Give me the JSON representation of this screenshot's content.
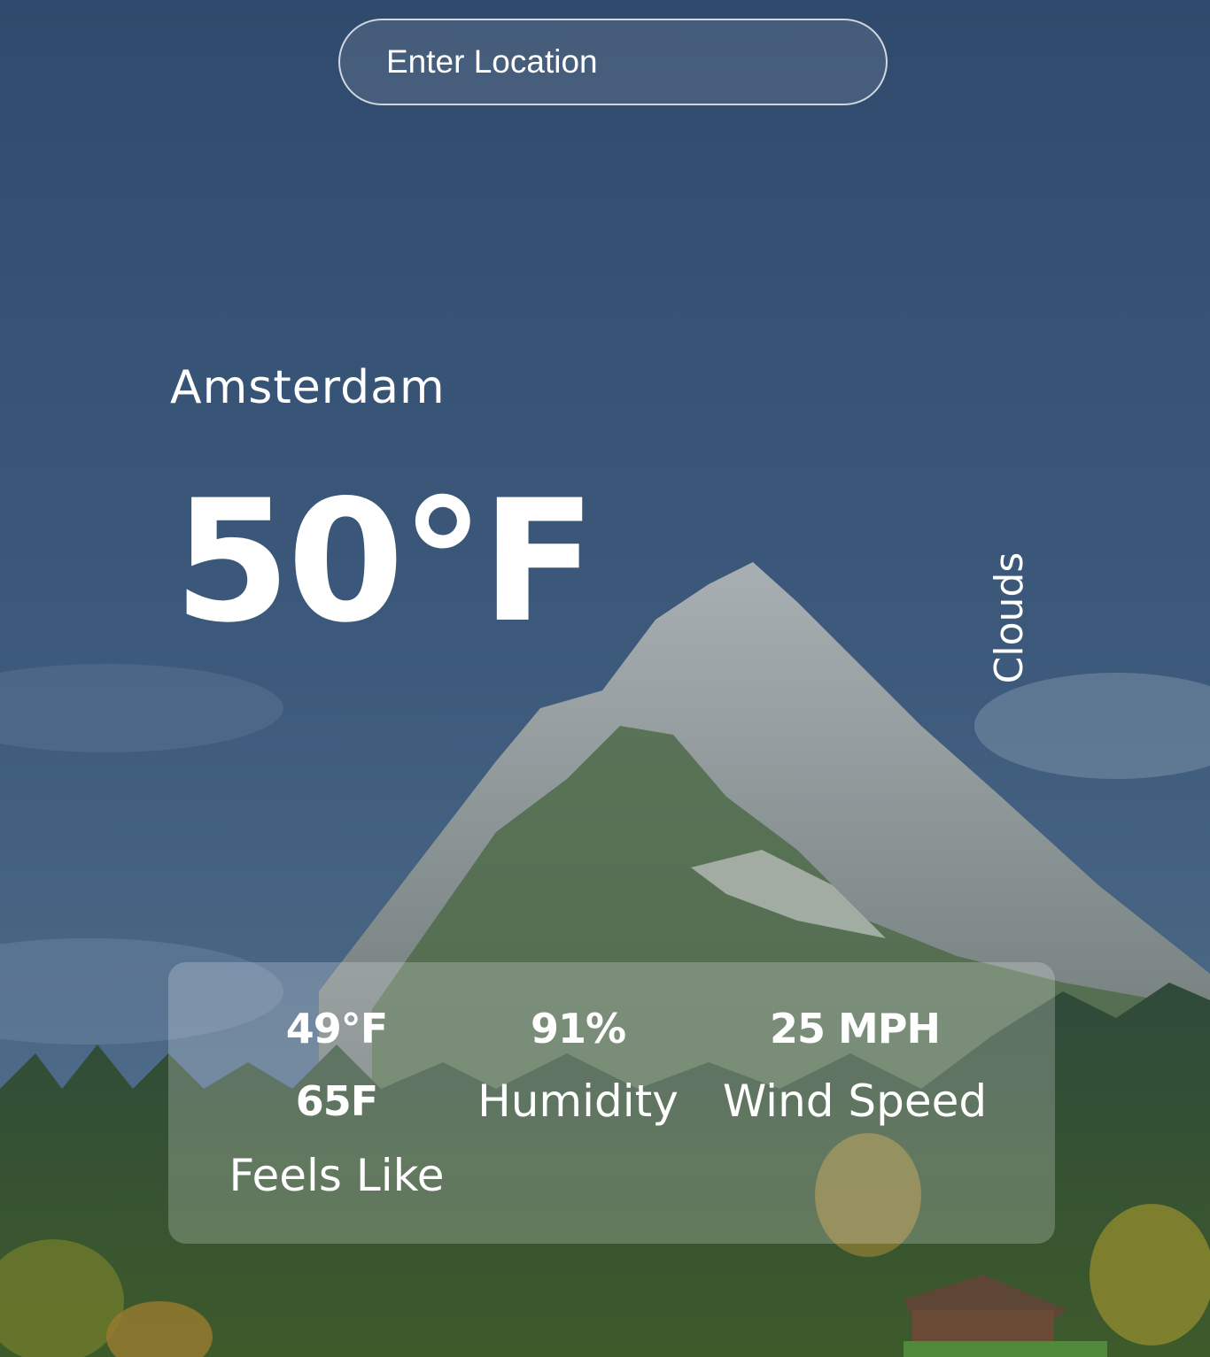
{
  "search": {
    "placeholder": "Enter Location"
  },
  "weather": {
    "city": "Amsterdam",
    "temperature": "50°F",
    "condition": "Clouds"
  },
  "stats": {
    "feels_like": {
      "value": "49°F",
      "secondary_value": "65F",
      "label": "Feels Like"
    },
    "humidity": {
      "value": "91%",
      "label": "Humidity"
    },
    "wind_speed": {
      "value": "25 MPH",
      "label": "Wind Speed"
    }
  },
  "colors": {
    "sky": "#3a5676",
    "text": "#ffffff",
    "card": "rgba(255,255,255,0.22)"
  }
}
